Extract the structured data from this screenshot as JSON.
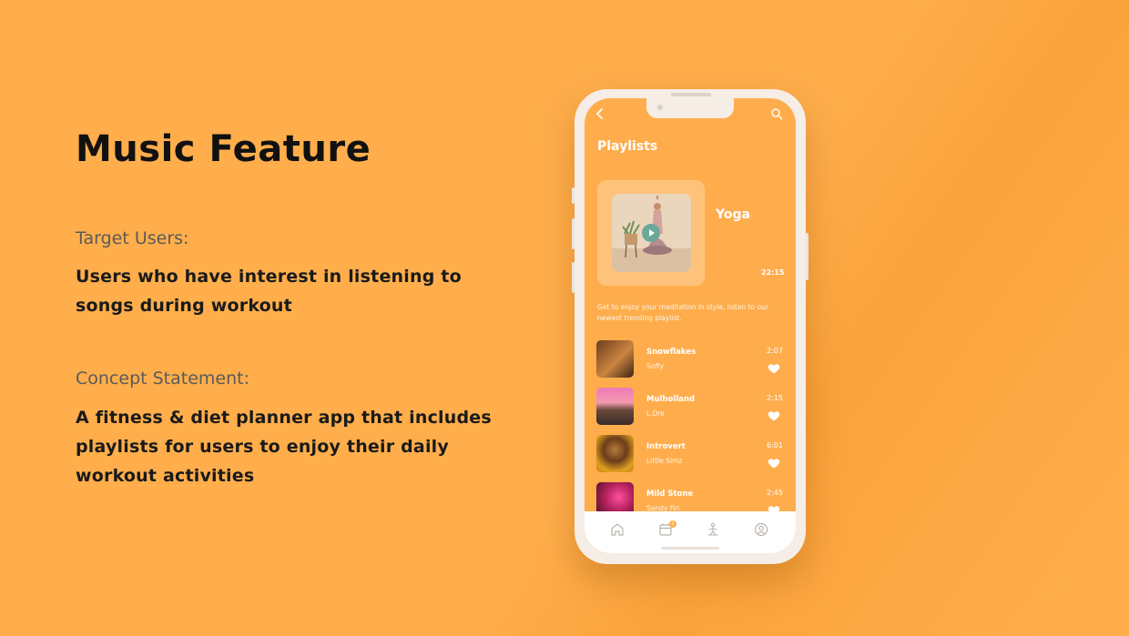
{
  "slide": {
    "title": "Music Feature",
    "target_label": "Target Users:",
    "target_text": "Users who have interest in listening to songs during workout",
    "concept_label": "Concept Statement:",
    "concept_text": "A fitness & diet planner app that includes playlists for users to enjoy their daily workout activities"
  },
  "app": {
    "header_title": "Playlists",
    "featured": {
      "name": "Yoga",
      "duration": "22:15",
      "description": "Get to enjoy your meditation in style, listen to our newest trending playlist."
    },
    "songs": [
      {
        "title": "Snowflakes",
        "artist": "Softy",
        "duration": "2:07"
      },
      {
        "title": "Mulholland",
        "artist": "L.Dre",
        "duration": "2:15"
      },
      {
        "title": "Introvert",
        "artist": "Little Simz",
        "duration": "6:01"
      },
      {
        "title": "Mild Stone",
        "artist": "Sandy Fin",
        "duration": "2:45"
      }
    ],
    "tabs": [
      "home-icon",
      "calendar-icon",
      "workout-icon",
      "profile-icon"
    ],
    "badge_count": "2"
  },
  "colors": {
    "background": "#ffae4b",
    "screen": "#ffad4c",
    "accent_green": "#6aa99a"
  }
}
